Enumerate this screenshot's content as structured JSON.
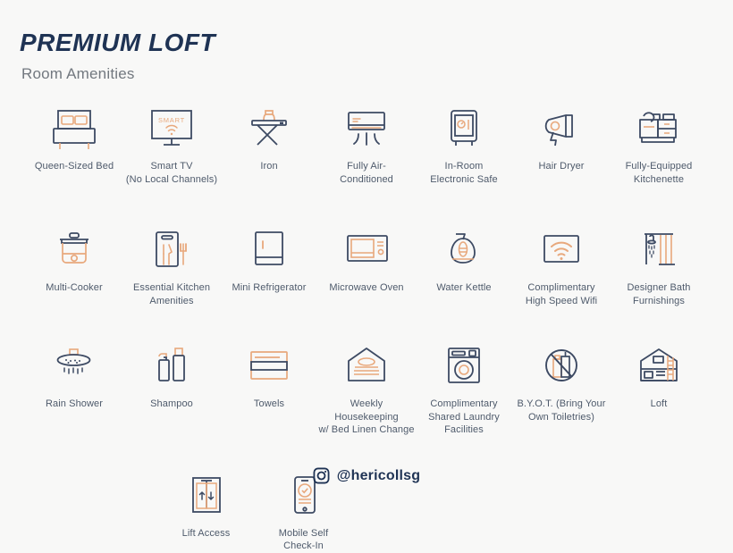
{
  "header": {
    "title": "PREMIUM LOFT",
    "subtitle": "Room Amenities"
  },
  "colors": {
    "background": "#f8f8f7",
    "navy": "#3d4a63",
    "title_navy": "#1f3354",
    "orange": "#e8a87c",
    "label_text": "#4e5a6b",
    "subtitle_gray": "#72787f"
  },
  "rows": [
    {
      "items": [
        {
          "icon": "bed-icon",
          "label": "Queen-Sized Bed"
        },
        {
          "icon": "smart-tv-icon",
          "label": "Smart TV\n(No Local Channels)"
        },
        {
          "icon": "iron-icon",
          "label": "Iron"
        },
        {
          "icon": "air-conditioner-icon",
          "label": "Fully Air-\nConditioned"
        },
        {
          "icon": "safe-icon",
          "label": "In-Room\nElectronic Safe"
        },
        {
          "icon": "hair-dryer-icon",
          "label": "Hair Dryer"
        },
        {
          "icon": "kitchenette-icon",
          "label": "Fully-Equipped\nKitchenette"
        }
      ]
    },
    {
      "items": [
        {
          "icon": "multi-cooker-icon",
          "label": "Multi-Cooker"
        },
        {
          "icon": "kitchen-utensils-icon",
          "label": "Essential Kitchen\nAmenities"
        },
        {
          "icon": "mini-refrigerator-icon",
          "label": "Mini Refrigerator"
        },
        {
          "icon": "microwave-icon",
          "label": "Microwave Oven"
        },
        {
          "icon": "kettle-icon",
          "label": "Water Kettle"
        },
        {
          "icon": "wifi-icon",
          "label": "Complimentary\nHigh Speed Wifi"
        },
        {
          "icon": "bath-furnishings-icon",
          "label": "Designer Bath\nFurnishings"
        }
      ]
    },
    {
      "items": [
        {
          "icon": "rain-shower-icon",
          "label": "Rain Shower"
        },
        {
          "icon": "shampoo-icon",
          "label": "Shampoo"
        },
        {
          "icon": "towels-icon",
          "label": "Towels"
        },
        {
          "icon": "housekeeping-icon",
          "label": "Weekly Housekeeping\nw/ Bed Linen Change"
        },
        {
          "icon": "laundry-icon",
          "label": "Complimentary\nShared Laundry\nFacilities"
        },
        {
          "icon": "no-toiletries-icon",
          "label": "B.Y.O.T. (Bring Your\nOwn Toiletries)"
        },
        {
          "icon": "loft-icon",
          "label": "Loft"
        }
      ]
    },
    {
      "items": [
        {
          "icon": "lift-icon",
          "label": "Lift Access"
        },
        {
          "icon": "mobile-checkin-icon",
          "label": "Mobile Self\nCheck-In"
        }
      ]
    }
  ],
  "footer": {
    "icon": "instagram-icon",
    "handle": "@hericollsg"
  }
}
